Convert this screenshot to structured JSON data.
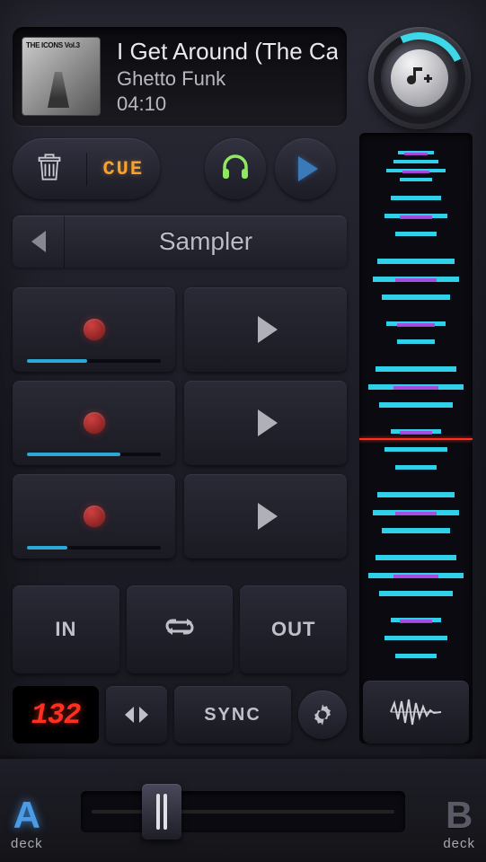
{
  "track": {
    "album": "THE ICONS Vol.3",
    "title": "I Get Around (The Ca",
    "artist": "Ghetto Funk",
    "duration": "04:10"
  },
  "toolbar": {
    "cue_label": "CUE"
  },
  "section": {
    "title": "Sampler"
  },
  "sampler": {
    "rows": [
      {
        "progress_pct": 45
      },
      {
        "progress_pct": 70
      },
      {
        "progress_pct": 30
      }
    ]
  },
  "loop": {
    "in_label": "IN",
    "out_label": "OUT"
  },
  "tempo": {
    "bpm": "132",
    "sync_label": "SYNC"
  },
  "decks": {
    "a_big": "A",
    "a_small": "deck",
    "b_big": "B",
    "b_small": "deck",
    "crossfader_pct": 25
  },
  "colors": {
    "accent_cyan": "#3dd8e8",
    "accent_orange": "#f8a030",
    "accent_red": "#ff3020",
    "accent_blue": "#4a9ce8"
  }
}
